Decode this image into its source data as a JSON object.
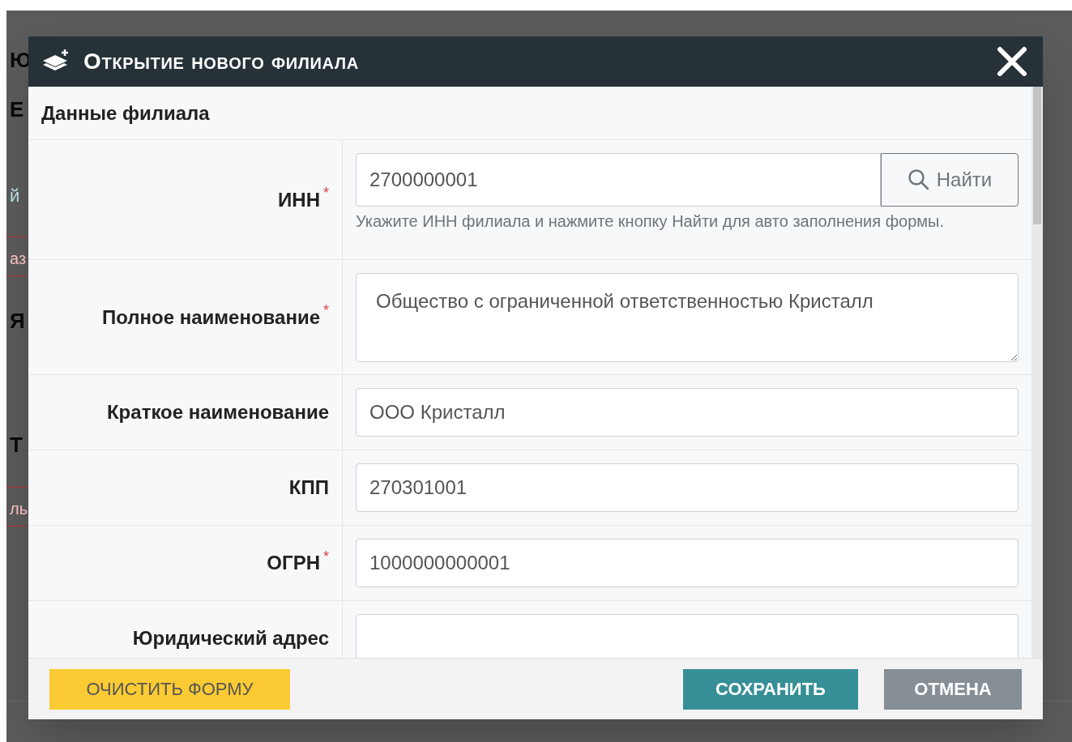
{
  "background": [
    {
      "kind": "heading",
      "text": "Ю"
    },
    {
      "kind": "heading",
      "text": "Е"
    },
    {
      "kind": "link",
      "text": "й"
    },
    {
      "kind": "tab",
      "text": "аз"
    },
    {
      "kind": "heading",
      "text": "Я"
    },
    {
      "kind": "heading",
      "text": "Т"
    },
    {
      "kind": "tab",
      "text": "ль"
    }
  ],
  "dialog": {
    "title": "Открытие нового филиала",
    "section_title": "Данные филиала",
    "fields": [
      {
        "kind": "search",
        "label": "ИНН",
        "required_mark": "*",
        "value": "2700000001",
        "button": "Найти",
        "help": "Укажите ИНН филиала и нажмите кнопку Найти для авто заполнения формы."
      },
      {
        "kind": "textarea",
        "label": "Полное наименование",
        "required_mark": "*",
        "value": "Общество с ограниченной ответственностью Кристалл"
      },
      {
        "kind": "input",
        "label": "Краткое наименование",
        "value": "ООО Кристалл"
      },
      {
        "kind": "input",
        "label": "КПП",
        "value": "270301001"
      },
      {
        "kind": "input",
        "label": "ОГРН",
        "required_mark": "*",
        "value": "1000000000001"
      },
      {
        "kind": "input",
        "label": "Юридический адрес"
      }
    ],
    "buttons": [
      {
        "kind": "clear",
        "label": "ОЧИСТИТЬ ФОРМУ"
      },
      {
        "kind": "save",
        "label": "СОХРАНИТЬ"
      },
      {
        "kind": "cancel",
        "label": "ОТМЕНА"
      }
    ]
  }
}
